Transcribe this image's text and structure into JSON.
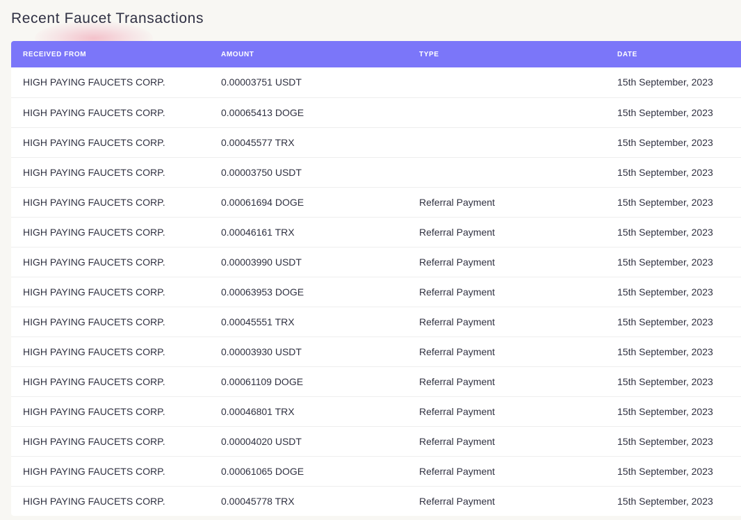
{
  "title": "Recent Faucet Transactions",
  "colors": {
    "header_bg": "#7b76f9",
    "page_bg": "#f8f7f3",
    "text": "#2f3040"
  },
  "table": {
    "headers": [
      "RECEIVED FROM",
      "AMOUNT",
      "TYPE",
      "DATE"
    ],
    "rows": [
      {
        "from": "HIGH PAYING FAUCETS CORP.",
        "amount": "0.00003751 USDT",
        "type": "",
        "date": "15th September, 2023"
      },
      {
        "from": "HIGH PAYING FAUCETS CORP.",
        "amount": "0.00065413 DOGE",
        "type": "",
        "date": "15th September, 2023"
      },
      {
        "from": "HIGH PAYING FAUCETS CORP.",
        "amount": "0.00045577 TRX",
        "type": "",
        "date": "15th September, 2023"
      },
      {
        "from": "HIGH PAYING FAUCETS CORP.",
        "amount": "0.00003750 USDT",
        "type": "",
        "date": "15th September, 2023"
      },
      {
        "from": "HIGH PAYING FAUCETS CORP.",
        "amount": "0.00061694 DOGE",
        "type": "Referral Payment",
        "date": "15th September, 2023"
      },
      {
        "from": "HIGH PAYING FAUCETS CORP.",
        "amount": "0.00046161 TRX",
        "type": "Referral Payment",
        "date": "15th September, 2023"
      },
      {
        "from": "HIGH PAYING FAUCETS CORP.",
        "amount": "0.00003990 USDT",
        "type": "Referral Payment",
        "date": "15th September, 2023"
      },
      {
        "from": "HIGH PAYING FAUCETS CORP.",
        "amount": "0.00063953 DOGE",
        "type": "Referral Payment",
        "date": "15th September, 2023"
      },
      {
        "from": "HIGH PAYING FAUCETS CORP.",
        "amount": "0.00045551 TRX",
        "type": "Referral Payment",
        "date": "15th September, 2023"
      },
      {
        "from": "HIGH PAYING FAUCETS CORP.",
        "amount": "0.00003930 USDT",
        "type": "Referral Payment",
        "date": "15th September, 2023"
      },
      {
        "from": "HIGH PAYING FAUCETS CORP.",
        "amount": "0.00061109 DOGE",
        "type": "Referral Payment",
        "date": "15th September, 2023"
      },
      {
        "from": "HIGH PAYING FAUCETS CORP.",
        "amount": "0.00046801 TRX",
        "type": "Referral Payment",
        "date": "15th September, 2023"
      },
      {
        "from": "HIGH PAYING FAUCETS CORP.",
        "amount": "0.00004020 USDT",
        "type": "Referral Payment",
        "date": "15th September, 2023"
      },
      {
        "from": "HIGH PAYING FAUCETS CORP.",
        "amount": "0.00061065 DOGE",
        "type": "Referral Payment",
        "date": "15th September, 2023"
      },
      {
        "from": "HIGH PAYING FAUCETS CORP.",
        "amount": "0.00045778 TRX",
        "type": "Referral Payment",
        "date": "15th September, 2023"
      }
    ]
  }
}
